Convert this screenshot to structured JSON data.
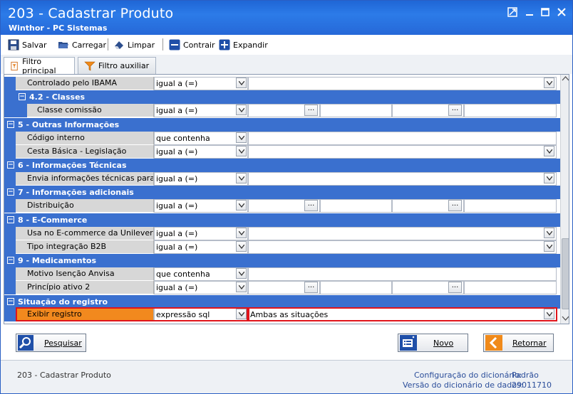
{
  "window": {
    "title": "203 - Cadastrar  Produto",
    "subtitle": "Winthor - PC Sistemas"
  },
  "toolbar": {
    "save_label": "Salvar",
    "load_label": "Carregar",
    "clear_label": "Limpar",
    "collapse_label": "Contrair",
    "expand_label": "Expandir"
  },
  "tabs": [
    {
      "label": "Filtro principal"
    },
    {
      "label": "Filtro auxiliar"
    }
  ],
  "grid": {
    "r0": {
      "name": "Controlado pelo IBAMA",
      "op": "igual a (=)"
    },
    "s42": {
      "label": "4.2 - Classes"
    },
    "r1": {
      "name": "Classe comissão",
      "op": "igual a (=)"
    },
    "s5": {
      "label": "5 - Outras Informações"
    },
    "r2": {
      "name": "Código interno",
      "op": "que contenha"
    },
    "r3": {
      "name": "Cesta Básica - Legislação",
      "op": "igual a (=)"
    },
    "s6": {
      "label": "6 - Informações Técnicas"
    },
    "r4": {
      "name": "Envia informações técnicas para NF-",
      "op": "igual a (=)"
    },
    "s7": {
      "label": "7 - Informações adicionais"
    },
    "r5": {
      "name": "Distribuição",
      "op": "igual a (=)"
    },
    "s8": {
      "label": "8 - E-Commerce"
    },
    "r6": {
      "name": "Usa no E-commerce da Unilever",
      "op": "igual a (=)"
    },
    "r7": {
      "name": "Tipo integração B2B",
      "op": "igual a (=)"
    },
    "s9": {
      "label": "9 - Medicamentos"
    },
    "r8": {
      "name": "Motivo Isenção Anvisa",
      "op": "que contenha"
    },
    "r9": {
      "name": "Princípio ativo 2",
      "op": "igual a (=)"
    },
    "s10": {
      "label": "Situação do registro"
    },
    "r10": {
      "name": "Exibir registro",
      "op": "expressão sql",
      "value": "Ambas as situações"
    },
    "ellipsis": "..."
  },
  "buttons": {
    "search": "Pesquisar",
    "new": "Novo",
    "back": "Retornar"
  },
  "footer": {
    "screen": "203 - Cadastrar  Produto",
    "dict_config_label": "Configuração do dicionário:",
    "dict_config_value": "Padrão",
    "dict_version_label": "Versão do dicionário de dados:",
    "dict_version_value": "29011710"
  },
  "colors": {
    "section_blue": "#3a70cf",
    "highlight_orange": "#f2891e",
    "highlight_border": "#e0141b"
  }
}
